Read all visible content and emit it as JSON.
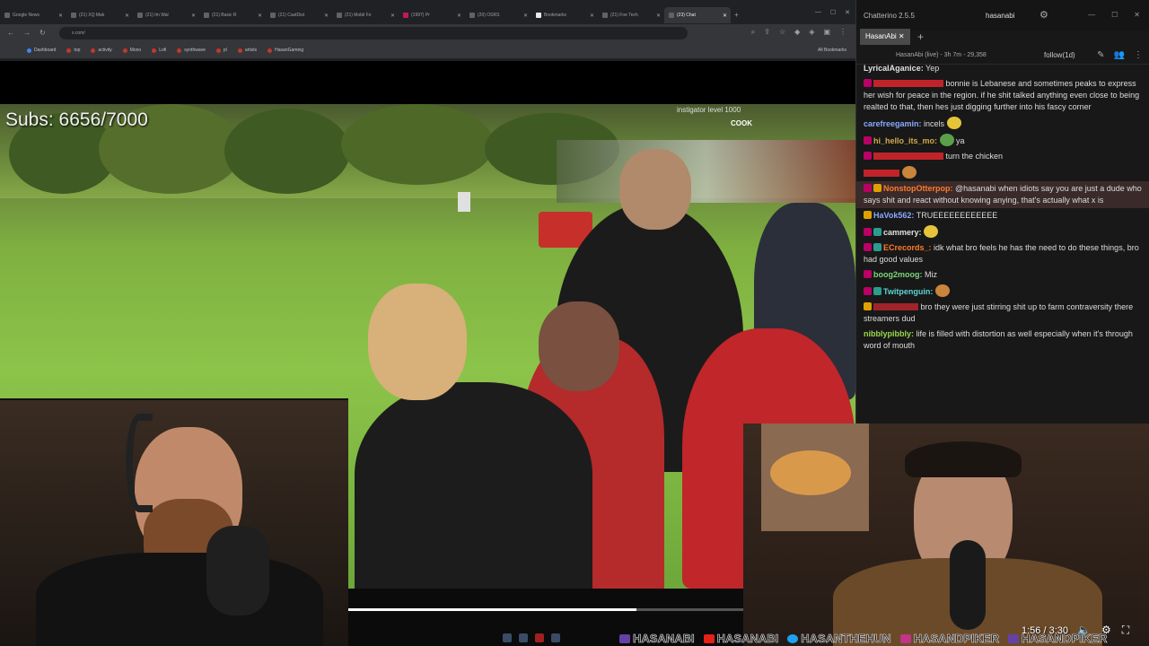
{
  "browser": {
    "tabs": [
      {
        "label": "Google News"
      },
      {
        "label": "(21) XQ Mak"
      },
      {
        "label": "(21) Im Wal"
      },
      {
        "label": "(21) Basic R"
      },
      {
        "label": "(21) CastDist"
      },
      {
        "label": "(21) Mobil Fo"
      },
      {
        "label": "(1997) Pr"
      },
      {
        "label": "(20) OSRS"
      },
      {
        "label": "Bookmarks"
      },
      {
        "label": "(21) Foe Tech"
      },
      {
        "label": "(23) Chat",
        "active": true
      }
    ],
    "url": "x.com/",
    "bookmarks": [
      "Dashboard",
      "top",
      "activity",
      "Mono",
      "Lofi",
      "synthwave",
      "pl",
      "artists",
      "HasanGaming"
    ],
    "all_bookmarks": "All Bookmarks"
  },
  "video": {
    "subs_label": "Subs: 6656/7000",
    "overlay_name": "instigator level 1000",
    "overlay_line2": "COOK"
  },
  "player": {
    "progress": 0.73,
    "time": "1:56 / 3:30"
  },
  "socials": [
    {
      "name": "HASANABI",
      "platform": "twitch-icon"
    },
    {
      "name": "HASANABI",
      "platform": "youtube-icon"
    },
    {
      "name": "HASANTHEHUN",
      "platform": "twitter-icon"
    },
    {
      "name": "HASANDPIKER",
      "platform": "instagram-icon"
    },
    {
      "name": "HASANDPIKER",
      "platform": "twitch-icon"
    }
  ],
  "chatterino": {
    "app_title": "Chatterino 2.5.5",
    "user": "hasanabi",
    "tab_label": "HasanAbi",
    "channel_info": "HasanAbi (live) - 3h 7m - 29,358",
    "follow": "follow(1d)",
    "messages": [
      {
        "user": "LyricalAganice:",
        "text": "Yep",
        "color": "u-white"
      },
      {
        "user": "",
        "text": "bonnie is Lebanese and sometimes peaks to express her wish for peace in the region. if he shit talked anything even close to being realted to that, then hes just digging further into his fascy corner",
        "color": "u-red"
      },
      {
        "user": "carefreegamin:",
        "text": "incels",
        "color": "u-blue"
      },
      {
        "user": "hi_hello_its_mo:",
        "text": "ya",
        "color": "u-gold"
      },
      {
        "user": "",
        "text": "turn the chicken",
        "color": "u-red"
      },
      {
        "user": "",
        "text": "",
        "color": "u-red"
      },
      {
        "user": "NonstopOtterpop:",
        "text": "@hasanabi when idiots say you are just a dude who says shit and react without knowing anying, that's actually what x is",
        "color": "u-orange"
      },
      {
        "user": "HaVok562:",
        "text": "TRUEEEEEEEEEEEE",
        "color": "u-blue"
      },
      {
        "user": "cammery:",
        "text": "",
        "color": "u-white"
      },
      {
        "user": "ECrecords_:",
        "text": "idk what bro feels he has the need to do these things, bro had good values",
        "color": "u-orange"
      },
      {
        "user": "boog2moog:",
        "text": "Miz",
        "color": "u-green"
      },
      {
        "user": "Twitpenguin:",
        "text": "",
        "color": "u-teal"
      },
      {
        "user": "",
        "text": "bro they were just stirring shit up to farm contraversity there streamers dud",
        "color": "u-purple"
      },
      {
        "user": "nibblypibbly:",
        "text": "life is filled with distortion as well especially when it's through word of mouth",
        "color": "u-lime"
      }
    ]
  }
}
